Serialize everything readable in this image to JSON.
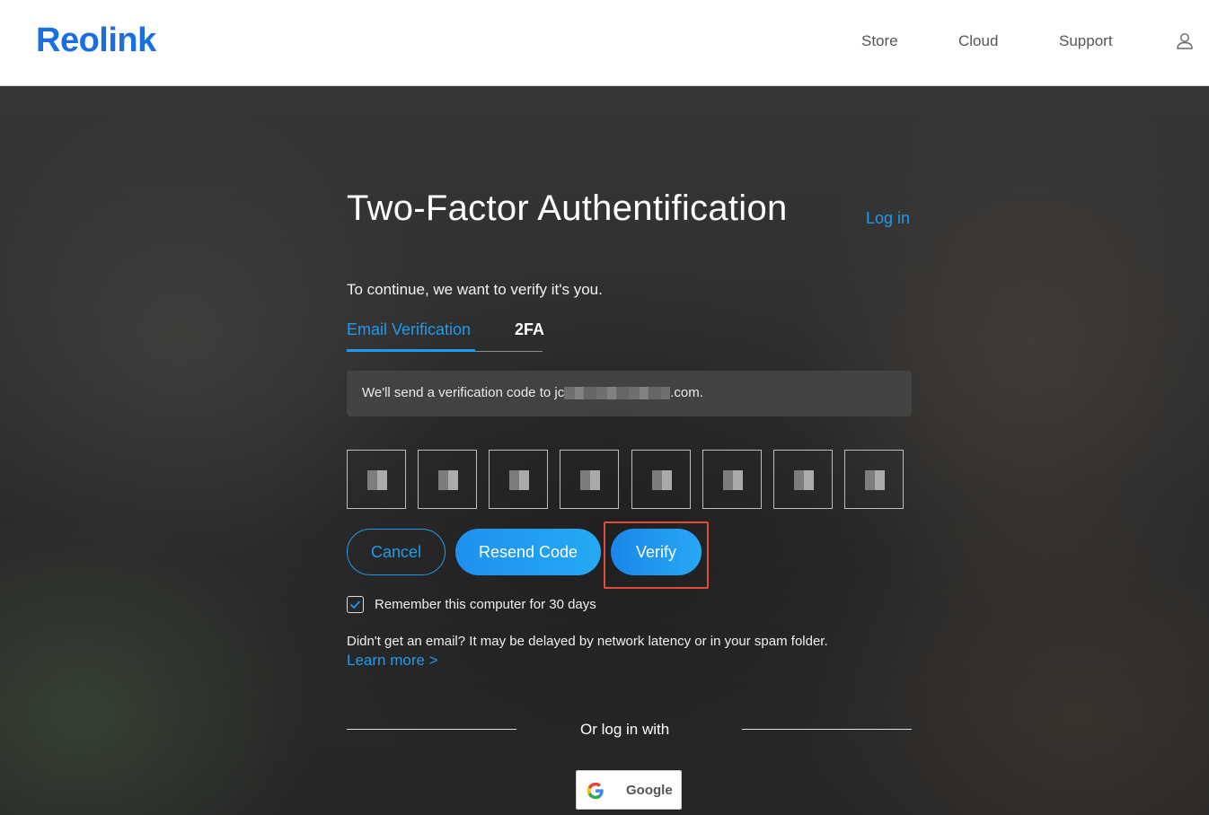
{
  "header": {
    "logo": "Reolink",
    "nav": [
      "Store",
      "Cloud",
      "Support"
    ],
    "user_icon": "user-icon"
  },
  "page": {
    "title": "Two-Factor Authentification",
    "login_link": "Log in",
    "subtitle": "To continue, we want to verify it's you.",
    "tabs": [
      {
        "label": "Email Verification",
        "active": true
      },
      {
        "label": "2FA",
        "active": false
      }
    ],
    "notice": {
      "prefix": "We'll send a verification code to jc",
      "suffix": ".com."
    },
    "code_boxes": 8,
    "buttons": {
      "cancel": "Cancel",
      "resend": "Resend Code",
      "verify": "Verify"
    },
    "remember": {
      "label": "Remember this computer for 30 days",
      "checked": true
    },
    "help_text": "Didn't get an email? It may be delayed by network latency or in your spam folder.",
    "learn_more": "Learn more >",
    "or_text": "Or log in with",
    "google_label": "Google"
  },
  "colors": {
    "accent": "#1e9bf0",
    "brand": "#1a6fe0",
    "highlight": "#e14b3b"
  }
}
